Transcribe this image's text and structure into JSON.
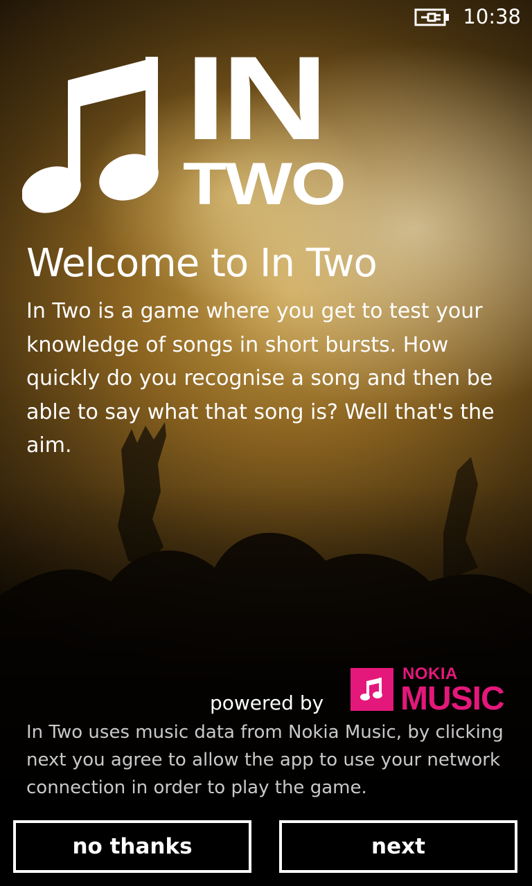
{
  "status_bar": {
    "time": "10:38",
    "battery_icon": "battery-charging-icon"
  },
  "logo": {
    "line1": "IN",
    "line2": "TWO",
    "icon": "music-note-icon"
  },
  "welcome": {
    "title": "Welcome to In Two",
    "description": "In Two is a game where you get to test your knowledge of songs in short bursts. How quickly do you recognise a song and then be able to say what that song is? Well that's the aim."
  },
  "powered": {
    "label": "powered by",
    "brand_top": "NOKIA",
    "brand_bottom": "MUSIC",
    "brand_color": "#e4187b"
  },
  "notice": "In Two uses music data from Nokia Music, by clicking next you agree to allow the app to use your network connection in order to play the game.",
  "buttons": {
    "decline": "no thanks",
    "accept": "next"
  }
}
